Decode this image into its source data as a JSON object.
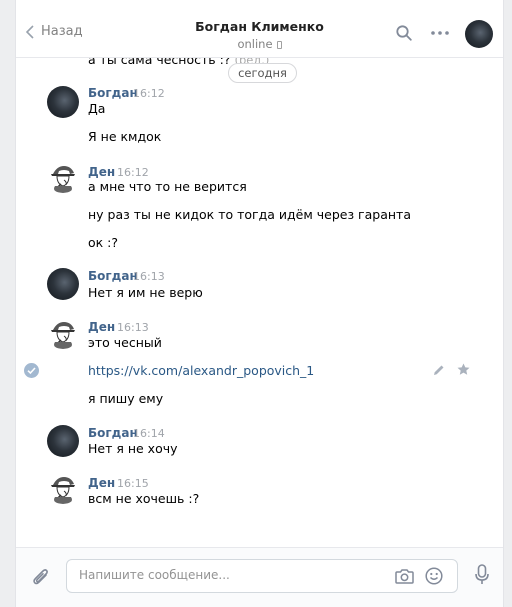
{
  "header": {
    "back_label": "Назад",
    "peer_name": "Богдан Клименко",
    "peer_status": "online"
  },
  "feed": {
    "cut_message": "а ты сама чесность :?",
    "cut_edited": "(ред.)",
    "date_divider": "сегодня"
  },
  "messages": [
    {
      "author": "Богдан",
      "time": "16:12",
      "lines": [
        "Да",
        "Я не кмдок"
      ]
    },
    {
      "author": "Ден",
      "time": "16:12",
      "lines": [
        "а мне что то не верится",
        "ну раз ты не кидок то тогда идём через гаранта",
        "ок :?"
      ]
    },
    {
      "author": "Богдан",
      "time": "16:13",
      "lines": [
        "Нет я им не верю"
      ]
    },
    {
      "author": "Ден",
      "time": "16:13",
      "lines": [
        "это чесный"
      ],
      "link": "https://vk.com/alexandr_popovich_1",
      "after_link": "я пишу ему"
    },
    {
      "author": "Богдан",
      "time": "16:14",
      "lines": [
        "Нет я не хочу"
      ]
    },
    {
      "author": "Ден",
      "time": "16:15",
      "lines": [
        "всм не хочешь :?"
      ]
    }
  ],
  "composer": {
    "placeholder": "Напишите сообщение..."
  }
}
